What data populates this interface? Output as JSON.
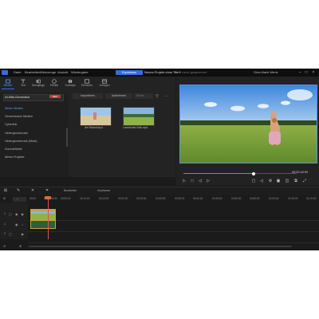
{
  "window": {
    "menu": [
      "Datei",
      "Bearbeiten",
      "Werkzeuge",
      "Ansicht",
      "Wiedergabe"
    ],
    "export_label": "Exportieren",
    "project_name": "Neues Projekt ohne Titel*",
    "project_status": "Nicht mehr gespeichert",
    "user": "Gina Marie Mertz"
  },
  "media_toolbar": [
    "Medien",
    "Text",
    "Übergänge",
    "Effekte",
    "Overlays",
    "Elemente",
    "Vorlagen"
  ],
  "library": {
    "selector": "AI-Bild-Generator",
    "selector_badge": "NEU",
    "tree": [
      "Meine Medien",
      "Gemeinsame Medien",
      "Cyberlink",
      "Hintergrundmusik",
      "Hintergrundmusik (Meta)",
      "Soundeffekte",
      "Meine Projekte"
    ],
    "filter_import": "Importieren",
    "filter_record": "Aufnehmen",
    "search_placeholder": "Suche ...",
    "thumbnails": [
      {
        "label": "Am Strand.mp4"
      },
      {
        "label": "Landschaft Gelb.mp4"
      }
    ]
  },
  "preview": {
    "timecode": "00:00:18:09",
    "progress": 0.62
  },
  "timeline": {
    "tool_labels": [
      "Bearbeiten",
      "Keyframes"
    ],
    "ruler": [
      "00:00",
      "00:05:00",
      "00:10:00",
      "00:15:00",
      "00:20:00",
      "00:25:00",
      "00:30:00",
      "00:35:00",
      "00:40:00",
      "00:45:00",
      "00:50:00",
      "00:55:00",
      "01:00:00",
      "01:05:00",
      "01:10:00"
    ],
    "ruler_start": "00:00:09:30"
  }
}
